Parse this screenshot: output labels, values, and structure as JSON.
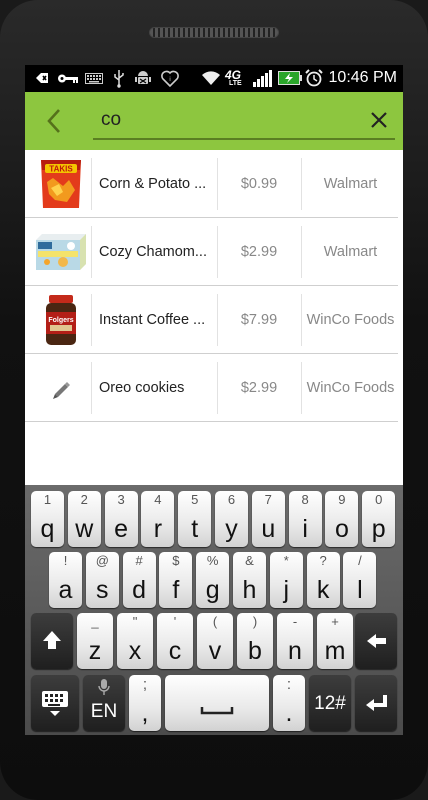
{
  "status_bar": {
    "time": "10:46 PM",
    "icons": [
      "keyboard-icon",
      "key-icon",
      "keyboard-alt-icon",
      "usb-icon",
      "android-debug-icon",
      "iheart-icon",
      "wifi-icon",
      "4g-lte-icon",
      "signal-icon",
      "battery-charging-icon",
      "alarm-icon"
    ],
    "network_label": "4G",
    "lte_label": "LTE"
  },
  "toolbar": {
    "search_value": "co",
    "accent_color": "#8dc63f"
  },
  "results": [
    {
      "name": "Corn & Potato ...",
      "price": "$0.99",
      "store": "Walmart",
      "thumb": "chips-bag-image"
    },
    {
      "name": "Cozy Chamom...",
      "price": "$2.99",
      "store": "Walmart",
      "thumb": "tea-box-image"
    },
    {
      "name": "Instant Coffee ...",
      "price": "$7.99",
      "store": "WinCo Foods",
      "thumb": "coffee-jar-image"
    },
    {
      "name": "Oreo cookies",
      "price": "$2.99",
      "store": "WinCo Foods",
      "thumb": "pencil-icon"
    }
  ],
  "thumb_text": {
    "chips": "TAKIS",
    "coffee": "Folgers"
  },
  "keyboard": {
    "row1": [
      {
        "sub": "1",
        "main": "q"
      },
      {
        "sub": "2",
        "main": "w"
      },
      {
        "sub": "3",
        "main": "e"
      },
      {
        "sub": "4",
        "main": "r"
      },
      {
        "sub": "5",
        "main": "t"
      },
      {
        "sub": "6",
        "main": "y"
      },
      {
        "sub": "7",
        "main": "u"
      },
      {
        "sub": "8",
        "main": "i"
      },
      {
        "sub": "9",
        "main": "o"
      },
      {
        "sub": "0",
        "main": "p"
      }
    ],
    "row2": [
      {
        "sub": "!",
        "main": "a"
      },
      {
        "sub": "@",
        "main": "s"
      },
      {
        "sub": "#",
        "main": "d"
      },
      {
        "sub": "$",
        "main": "f"
      },
      {
        "sub": "%",
        "main": "g"
      },
      {
        "sub": "&",
        "main": "h"
      },
      {
        "sub": "*",
        "main": "j"
      },
      {
        "sub": "?",
        "main": "k"
      },
      {
        "sub": "/",
        "main": "l"
      }
    ],
    "row3": [
      {
        "sub": "_",
        "main": "z"
      },
      {
        "sub": "\"",
        "main": "x"
      },
      {
        "sub": "'",
        "main": "c"
      },
      {
        "sub": "(",
        "main": "v"
      },
      {
        "sub": ")",
        "main": "b"
      },
      {
        "sub": "-",
        "main": "n"
      },
      {
        "sub": "+",
        "main": "m"
      }
    ],
    "lang_label": "EN",
    "semicolon_sub": ";",
    "comma_main": ",",
    "colon_sub": ":",
    "period_main": ".",
    "symbols_label": "12#"
  }
}
